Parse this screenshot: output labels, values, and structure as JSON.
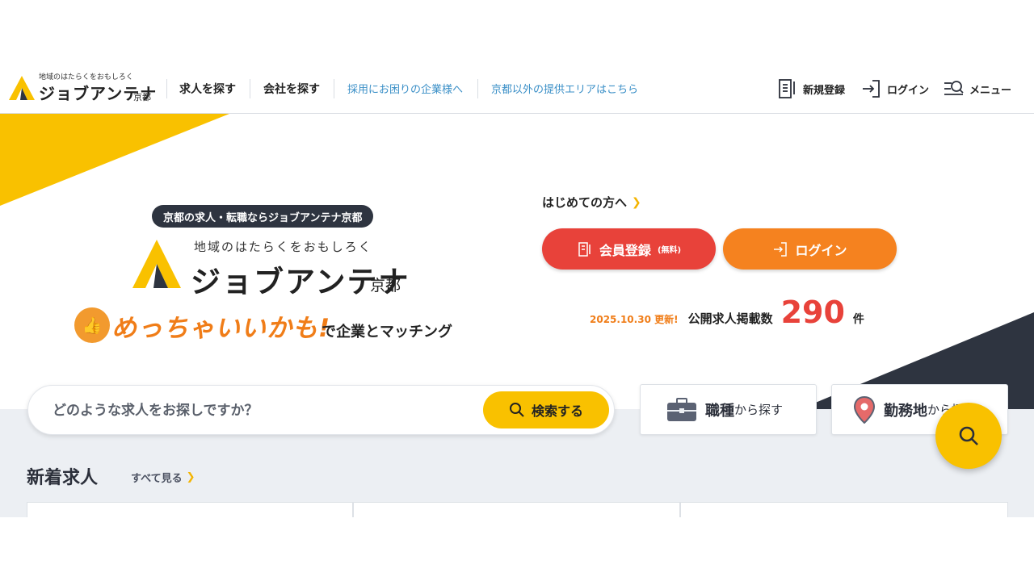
{
  "header": {
    "logo_tagline": "地域のはたらくをおもしろく",
    "logo_name": "ジョブアンテナ",
    "logo_city": "京都",
    "nav": [
      {
        "label": "求人を探す"
      },
      {
        "label": "会社を探す"
      }
    ],
    "links": [
      {
        "label": "採用にお困りの企業様へ"
      },
      {
        "label": "京都以外の提供エリアはこちら"
      }
    ],
    "register_label": "新規登録",
    "login_label": "ログイン",
    "menu_label": "メニュー"
  },
  "hero": {
    "pill": "京都の求人・転職ならジョブアンテナ京都",
    "tagline": "地域のはたらくをおもしろく",
    "name": "ジョブアンテナ",
    "city": "京都",
    "catch": "めっちゃいいかも!",
    "catch_sub": "で企業とマッチング",
    "first_time_label": "はじめての方へ",
    "register_label": "会員登録",
    "register_note": "(無料)",
    "login_label": "ログイン",
    "updated": "2025.10.30 更新!",
    "count_label": "公開求人掲載数",
    "count": "290",
    "count_unit": "件"
  },
  "search": {
    "placeholder": "どのような求人をお探しですか？",
    "button_label": "検索する"
  },
  "browse": {
    "job_big": "職種",
    "job_small": "から探す",
    "area_big": "勤務地",
    "area_small": "から探す"
  },
  "new_jobs": {
    "title": "新着求人",
    "see_all": "すべて見る"
  },
  "colors": {
    "accent_yellow": "#f9c100",
    "register_red": "#e8423a",
    "login_orange": "#f5821f",
    "navy": "#2e3440",
    "link_blue": "#3a8fc7"
  }
}
